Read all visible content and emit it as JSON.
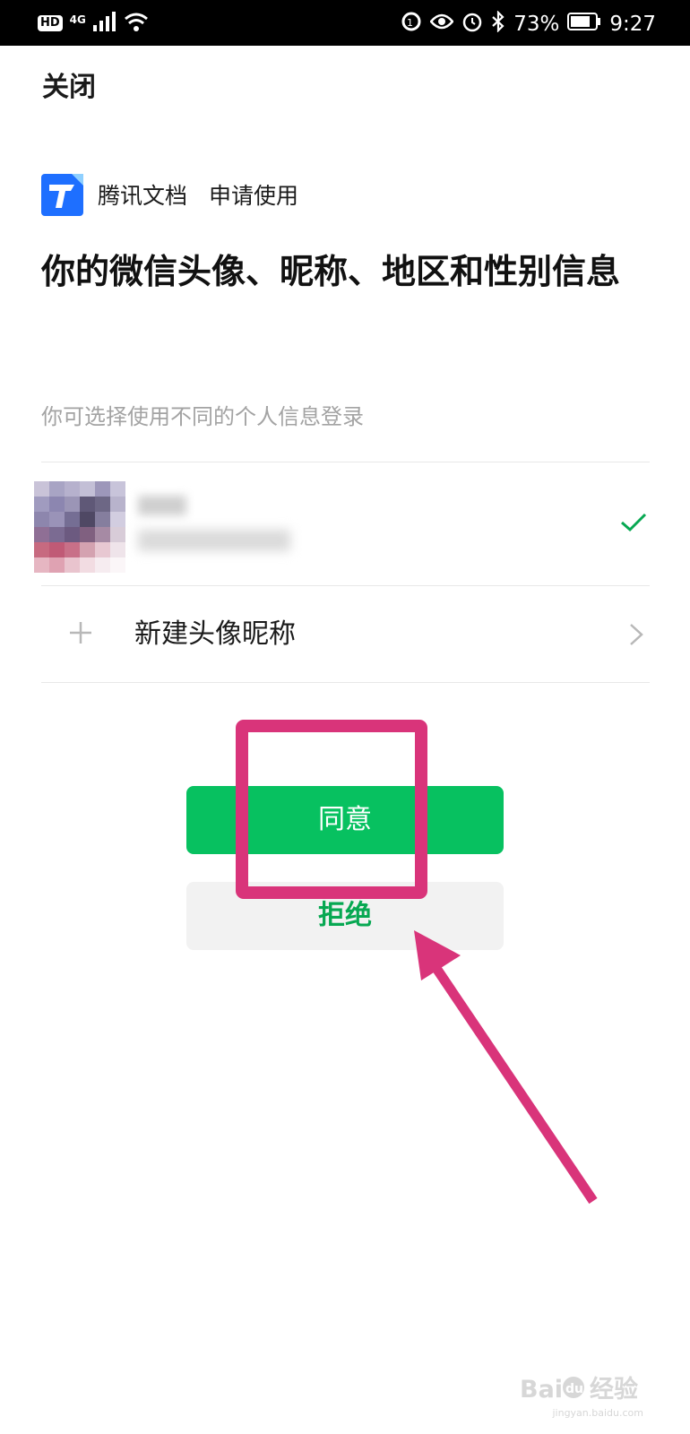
{
  "status_bar": {
    "left_badge": "HD",
    "network": "4G",
    "battery": "73%",
    "time": "9:27"
  },
  "header": {
    "close_label": "关闭"
  },
  "app": {
    "name": "腾讯文档",
    "request_label": "申请使用"
  },
  "title": "你的微信头像、昵称、地区和性别信息",
  "hint": "你可选择使用不同的个人信息登录",
  "new_profile": {
    "label": "新建头像昵称"
  },
  "buttons": {
    "agree": "同意",
    "reject": "拒绝"
  },
  "icons": [
    "hd-icon",
    "signal-icon",
    "wifi-icon",
    "eye-icon",
    "alarm-icon",
    "bluetooth-icon",
    "battery-icon",
    "check-icon",
    "plus-icon",
    "chevron-right-icon"
  ],
  "colors": {
    "accent_green": "#07c160",
    "annotation_pink": "#d9347a",
    "logo_blue": "#1e6fff"
  },
  "watermark": {
    "brand": "Bai du 经验",
    "domain": "jingyan.baidu.com"
  }
}
